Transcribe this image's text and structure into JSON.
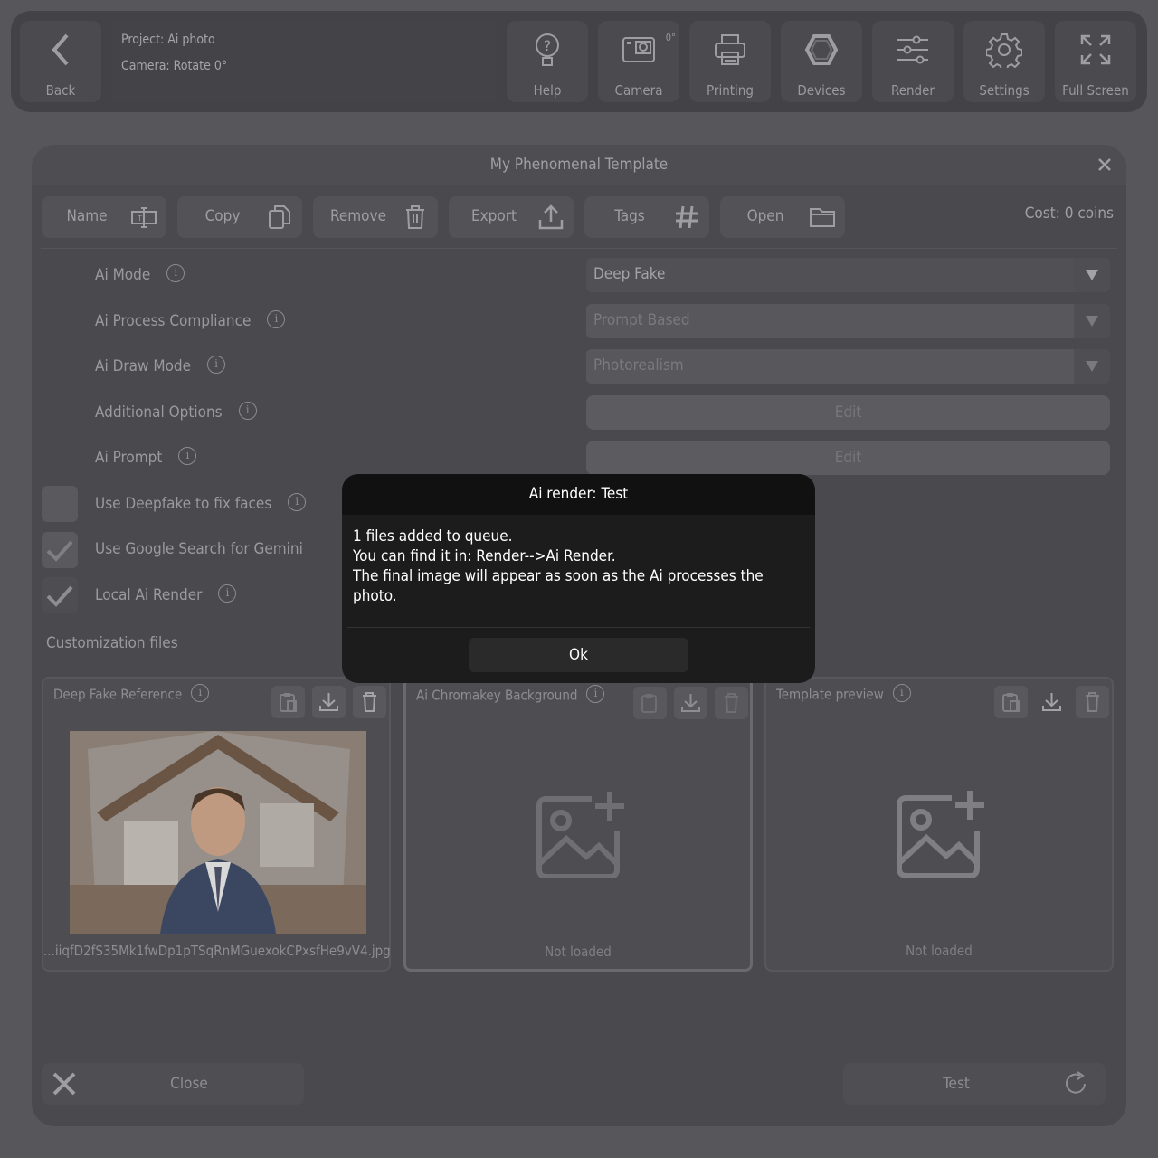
{
  "topbar": {
    "back_label": "Back",
    "project_line": "Project: Ai photo",
    "camera_line": "Camera: Rotate 0°",
    "buttons": [
      {
        "label": "Help",
        "icon": "help-icon"
      },
      {
        "label": "Camera",
        "icon": "camera-icon",
        "badge": "0°"
      },
      {
        "label": "Printing",
        "icon": "printer-icon"
      },
      {
        "label": "Devices",
        "icon": "hexagon-icon"
      },
      {
        "label": "Render",
        "icon": "sliders-icon"
      },
      {
        "label": "Settings",
        "icon": "gear-icon"
      },
      {
        "label": "Full Screen",
        "icon": "fullscreen-icon"
      }
    ]
  },
  "dialog": {
    "title": "My Phenomenal Template",
    "toolbar": [
      {
        "label": "Name",
        "icon": "rename-icon"
      },
      {
        "label": "Copy",
        "icon": "copy-icon"
      },
      {
        "label": "Remove",
        "icon": "trash-icon"
      },
      {
        "label": "Export",
        "icon": "upload-icon"
      },
      {
        "label": "Tags",
        "icon": "hash-icon"
      },
      {
        "label": "Open",
        "icon": "folder-icon"
      }
    ],
    "cost": "Cost: 0 coins",
    "rows": [
      {
        "label": "Ai Mode",
        "value": "Deep Fake"
      },
      {
        "label": "Ai Process Compliance",
        "value": "Prompt Based"
      },
      {
        "label": "Ai Draw Mode",
        "value": "Photorealism"
      },
      {
        "label": "Additional Options",
        "value": "Edit"
      },
      {
        "label": "Ai Prompt",
        "value": "Edit"
      }
    ],
    "checks": [
      {
        "label": "Use Deepfake to fix faces",
        "checked": false
      },
      {
        "label": "Use Google Search for Gemini",
        "checked": true
      },
      {
        "label": "Local Ai Render",
        "checked": true
      }
    ],
    "section_title": "Customization files",
    "panels": [
      {
        "title": "Deep Fake Reference",
        "file": "...iiqfD2fS35Mk1fwDp1pTSqRnMGuexokCPxsfHe9vV4.jpg"
      },
      {
        "title": "Ai Chromakey Background",
        "status": "Not loaded"
      },
      {
        "title": "Template preview",
        "status": "Not loaded"
      }
    ],
    "close_label": "Close",
    "test_label": "Test"
  },
  "modal": {
    "title": "Ai render: Test",
    "line1": "1 files added to queue.",
    "line2": "You can find it in: Render-->Ai Render.",
    "line3": "The final image will appear as soon as the Ai processes the photo.",
    "ok_label": "Ok"
  }
}
